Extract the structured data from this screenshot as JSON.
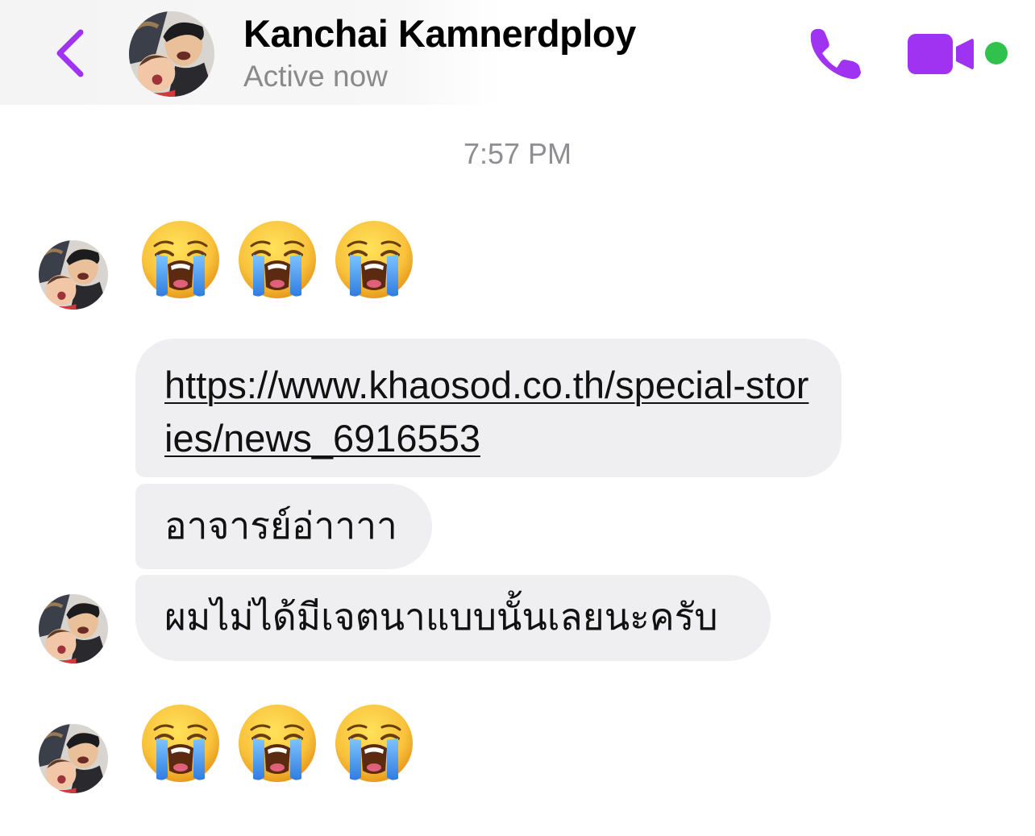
{
  "header": {
    "contact_name": "Kanchai Kamnerdploy",
    "status": "Active now",
    "accent_color": "#a033f2",
    "online_color": "#31c24d"
  },
  "conversation": {
    "timestamp": "7:57 PM",
    "messages": [
      {
        "type": "emoji",
        "content": [
          "loudly-crying-face",
          "loudly-crying-face",
          "loudly-crying-face"
        ]
      },
      {
        "type": "link",
        "text": "https://www.khaosod.co.th/special-stories/news_6916553"
      },
      {
        "type": "text",
        "text": "อาจารย์อ่าาาา"
      },
      {
        "type": "text",
        "text": "ผมไม่ได้มีเจตนาแบบนั้นเลยนะครับ"
      },
      {
        "type": "emoji",
        "content": [
          "loudly-crying-face",
          "loudly-crying-face",
          "loudly-crying-face"
        ]
      }
    ]
  }
}
